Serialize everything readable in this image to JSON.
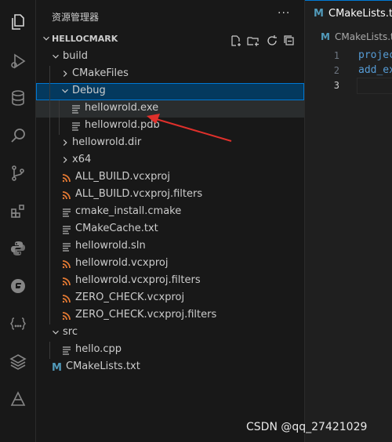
{
  "explorer": {
    "title": "资源管理器",
    "more": "···",
    "root": "HELLOCMARK"
  },
  "tree": [
    {
      "label": "build",
      "kind": "folder-open",
      "depth": 1
    },
    {
      "label": "CMakeFiles",
      "kind": "folder",
      "depth": 2
    },
    {
      "label": "Debug",
      "kind": "folder-open",
      "depth": 2,
      "state": "selected"
    },
    {
      "label": "hellowrold.exe",
      "kind": "lines",
      "depth": 3,
      "state": "hover"
    },
    {
      "label": "hellowrold.pdb",
      "kind": "lines",
      "depth": 3
    },
    {
      "label": "hellowrold.dir",
      "kind": "folder",
      "depth": 2
    },
    {
      "label": "x64",
      "kind": "folder",
      "depth": 2
    },
    {
      "label": "ALL_BUILD.vcxproj",
      "kind": "rss",
      "depth": 2
    },
    {
      "label": "ALL_BUILD.vcxproj.filters",
      "kind": "rss",
      "depth": 2
    },
    {
      "label": "cmake_install.cmake",
      "kind": "lines",
      "depth": 2
    },
    {
      "label": "CMakeCache.txt",
      "kind": "lines",
      "depth": 2
    },
    {
      "label": "hellowrold.sln",
      "kind": "lines",
      "depth": 2
    },
    {
      "label": "hellowrold.vcxproj",
      "kind": "rss",
      "depth": 2
    },
    {
      "label": "hellowrold.vcxproj.filters",
      "kind": "rss",
      "depth": 2
    },
    {
      "label": "ZERO_CHECK.vcxproj",
      "kind": "rss",
      "depth": 2
    },
    {
      "label": "ZERO_CHECK.vcxproj.filters",
      "kind": "rss",
      "depth": 2
    },
    {
      "label": "src",
      "kind": "folder-open",
      "depth": 1
    },
    {
      "label": "hello.cpp",
      "kind": "lines",
      "depth": 2
    },
    {
      "label": "CMakeLists.txt",
      "kind": "cmake",
      "depth": 1
    }
  ],
  "editor": {
    "tab_label": "CMakeLists.txt",
    "breadcrumb": "CMakeLists.txt",
    "lines": [
      {
        "num": "1",
        "text": "projec"
      },
      {
        "num": "2",
        "text": "add_ex"
      },
      {
        "num": "3",
        "text": ""
      }
    ]
  },
  "watermark": "CSDN @qq_27421029",
  "colors": {
    "accent": "#0078d4",
    "selection": "#04395e",
    "rss": "#e37933",
    "cmake": "#519aba",
    "arrow": "#e0302b"
  }
}
